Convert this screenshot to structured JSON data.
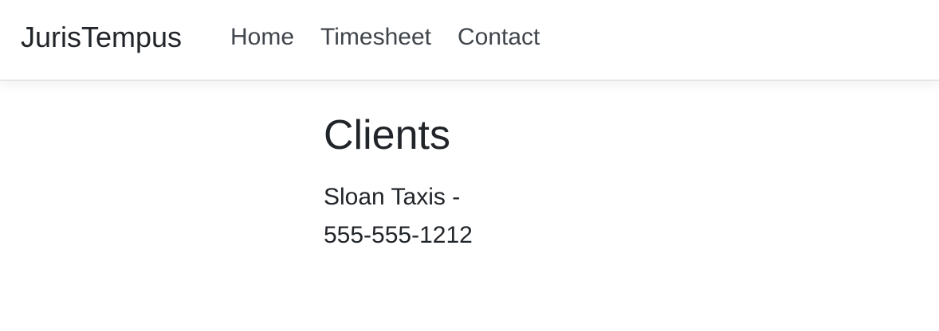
{
  "navbar": {
    "brand": "JurisTempus",
    "links": [
      {
        "label": "Home"
      },
      {
        "label": "Timesheet"
      },
      {
        "label": "Contact"
      }
    ]
  },
  "main": {
    "title": "Clients",
    "clients": [
      {
        "name_line": "Sloan Taxis -",
        "phone": "555-555-1212"
      }
    ]
  }
}
